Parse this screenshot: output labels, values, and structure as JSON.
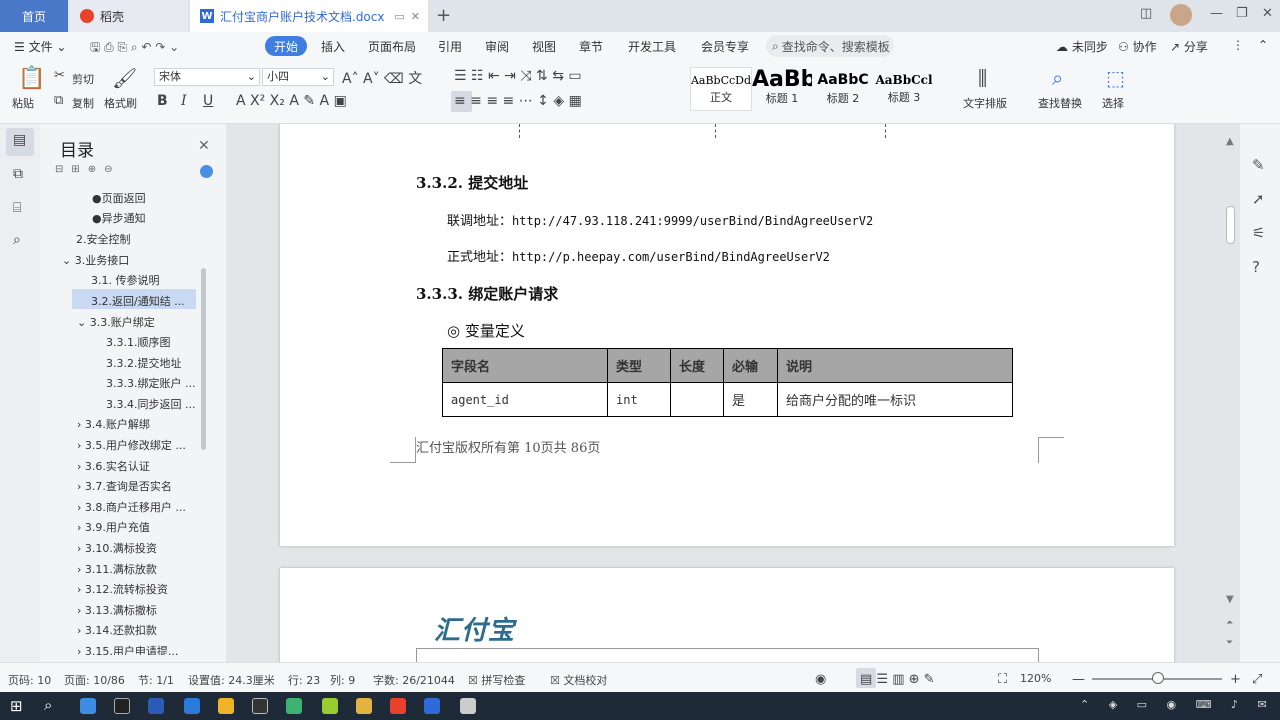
{
  "tabs": {
    "home": "首页",
    "wps": "稻壳",
    "doc": "汇付宝商户账户技术文档.docx"
  },
  "menu": {
    "file": "文件",
    "items": [
      "开始",
      "插入",
      "页面布局",
      "引用",
      "审阅",
      "视图",
      "章节",
      "开发工具",
      "会员专享"
    ],
    "search": "查找命令、搜索模板",
    "right": [
      "未同步",
      "协作",
      "分享"
    ]
  },
  "ribbon": {
    "paste": "粘贴",
    "cut": "剪切",
    "copy": "复制",
    "format_painter": "格式刷",
    "font": "宋体",
    "size": "小四",
    "styles": [
      {
        "sample": "AaBbCcDd",
        "name": "正文"
      },
      {
        "sample": "AaBb",
        "name": "标题 1"
      },
      {
        "sample": "AaBbC",
        "name": "标题 2"
      },
      {
        "sample": "AaBbCcl",
        "name": "标题 3"
      }
    ],
    "text_layout": "文字排版",
    "find_replace": "查找替换",
    "select": "选择"
  },
  "toc": {
    "title": "目录",
    "items": [
      "●页面返回",
      "●异步通知",
      "2.安全控制",
      "3.业务接口",
      "3.1. 传参说明",
      "3.2.返回/通知结 ...",
      "3.3.账户绑定",
      "3.3.1.顺序图",
      "3.3.2.提交地址",
      "3.3.3.绑定账户 ...",
      "3.3.4.同步返回 ...",
      "3.4.账户解绑",
      "3.5.用户修改绑定 ...",
      "3.6.实名认证",
      "3.7.查询是否实名",
      "3.8.商户迁移用户 ...",
      "3.9.用户充值",
      "3.10.满标投资",
      "3.11.满标放款",
      "3.12.流转标投资",
      "3.13.满标撤标",
      "3.14.还款扣款",
      "3.15.用户申请提..."
    ]
  },
  "document": {
    "h332": "3.3.2.  提交地址",
    "test_label": "联调地址：",
    "test_url": "http://47.93.118.241:9999/userBind/BindAgreeUserV2",
    "prod_label": "正式地址：",
    "prod_url": "http://p.heepay.com/userBind/BindAgreeUserV2",
    "h333": "3.3.3.  绑定账户请求",
    "var_def": "◎  变量定义",
    "table": {
      "headers": [
        "字段名",
        "类型",
        "长度",
        "必输",
        "说明"
      ],
      "rows": [
        [
          "agent_id",
          "int",
          "",
          "是",
          "给商户分配的唯一标识"
        ]
      ]
    },
    "footer": "汇付宝版权所有第 10页共 86页",
    "logo": "汇付宝"
  },
  "status": {
    "page_code": "页码: 10",
    "page": "页面: 10/86",
    "section": "节: 1/1",
    "setting": "设置值: 24.3厘米",
    "row": "行: 23",
    "col": "列: 9",
    "words": "字数: 26/21044",
    "spell": "拼写检查",
    "proof": "文档校对",
    "zoom": "120%"
  }
}
